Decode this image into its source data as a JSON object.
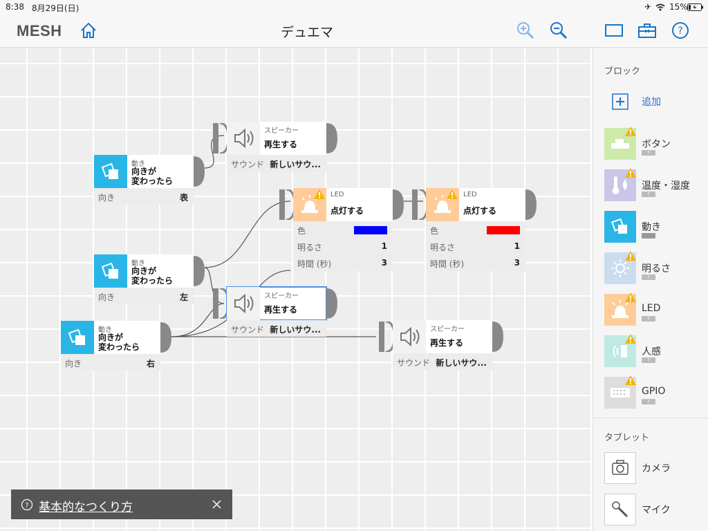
{
  "status": {
    "time": "8:38",
    "date": "8月29日(日)",
    "battery": "15%"
  },
  "nav": {
    "logo": "MESH",
    "title": "デュエマ"
  },
  "blocks": {
    "motion1": {
      "category": "動き",
      "title": "向きが\n変わったら",
      "props": [
        {
          "label": "向き",
          "value": "表"
        }
      ]
    },
    "motion2": {
      "category": "動き",
      "title": "向きが\n変わったら",
      "props": [
        {
          "label": "向き",
          "value": "左"
        }
      ]
    },
    "motion3": {
      "category": "動き",
      "title": "向きが\n変わったら",
      "props": [
        {
          "label": "向き",
          "value": "右"
        }
      ]
    },
    "speaker1": {
      "category": "スピーカー",
      "title": "再生する",
      "props": [
        {
          "label": "サウンド",
          "value": "新しいサウ..."
        }
      ]
    },
    "speaker2": {
      "category": "スピーカー",
      "title": "再生する",
      "props": [
        {
          "label": "サウンド",
          "value": "新しいサウ..."
        }
      ]
    },
    "speaker3": {
      "category": "スピーカー",
      "title": "再生する",
      "props": [
        {
          "label": "サウンド",
          "value": "新しいサウ..."
        }
      ]
    },
    "led1": {
      "category": "LED",
      "title": "点灯する",
      "props": [
        {
          "label": "色",
          "color": "#0000ff"
        },
        {
          "label": "明るさ",
          "value": "1"
        },
        {
          "label": "時間 (秒)",
          "value": "3"
        }
      ]
    },
    "led2": {
      "category": "LED",
      "title": "点灯する",
      "props": [
        {
          "label": "色",
          "color": "#ff0000"
        },
        {
          "label": "明るさ",
          "value": "1"
        },
        {
          "label": "時間 (秒)",
          "value": "3"
        }
      ]
    }
  },
  "sidebar": {
    "block_header": "ブロック",
    "add_label": "追加",
    "items": [
      {
        "label": "ボタン",
        "badge": "?"
      },
      {
        "label": "温度・湿度",
        "badge": "?"
      },
      {
        "label": "動き"
      },
      {
        "label": "明るさ",
        "badge": "?"
      },
      {
        "label": "LED",
        "badge": "?"
      },
      {
        "label": "人感",
        "badge": "?"
      },
      {
        "label": "GPIO",
        "badge": "?"
      }
    ],
    "tablet_header": "タブレット",
    "tablet_items": [
      {
        "label": "カメラ"
      },
      {
        "label": "マイク"
      }
    ]
  },
  "toast": {
    "text": "基本的なつくり方"
  },
  "colors": {
    "accent": "#1a73c8",
    "motion": "#29b6e6",
    "led": "#ffcc99",
    "warning": "#f5b400"
  }
}
